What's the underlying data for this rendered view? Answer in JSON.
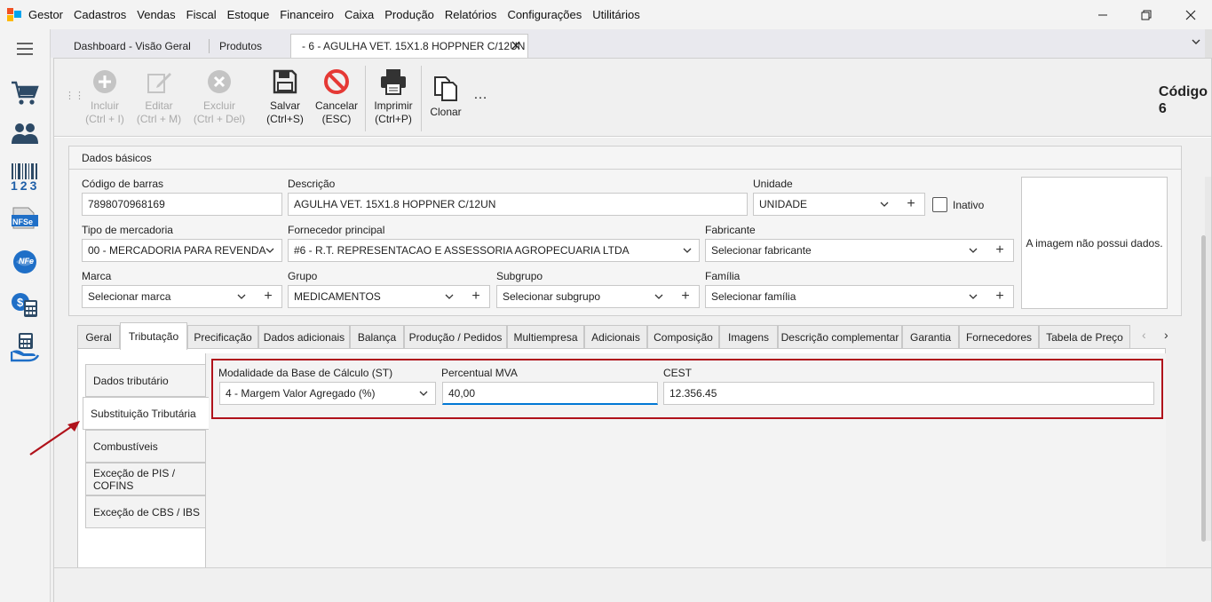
{
  "menu": {
    "items": [
      "Gestor",
      "Cadastros",
      "Vendas",
      "Fiscal",
      "Estoque",
      "Financeiro",
      "Caixa",
      "Produção",
      "Relatórios",
      "Configurações",
      "Utilitários"
    ]
  },
  "window": {
    "minimize": "—",
    "restore": "❐",
    "close": "✕"
  },
  "sidebar": {
    "icons": [
      "hamburger-menu-icon",
      "cart-icon",
      "users-icon",
      "barcode-123-icon",
      "nfse-icon",
      "nfe-icon",
      "calculator-icon",
      "cash-register-icon"
    ],
    "barcode_digits": "123",
    "nfse_text": "NFSe",
    "nfe_text": "NFe"
  },
  "doc_tabs": {
    "dashboard": "Dashboard - Visão Geral",
    "produtos": "Produtos",
    "produto_atual": "- 6 - AGULHA VET. 15X1.8 HOPPNER C/12UN",
    "close": "✕",
    "overflow": "⌄"
  },
  "toolbar": {
    "incluir": [
      "Incluir",
      "(Ctrl + I)"
    ],
    "editar": [
      "Editar",
      "(Ctrl + M)"
    ],
    "excluir": [
      "Excluir",
      "(Ctrl + Del)"
    ],
    "salvar": [
      "Salvar",
      "(Ctrl+S)"
    ],
    "cancelar": [
      "Cancelar",
      "(ESC)"
    ],
    "imprimir": [
      "Imprimir",
      "(Ctrl+P)"
    ],
    "clonar": "Clonar",
    "more": "…",
    "grip": "⋮⋮"
  },
  "codigo": {
    "label": "Código",
    "value": "6"
  },
  "dados_basicos": {
    "title": "Dados básicos",
    "codigo_barras": {
      "label": "Código de barras",
      "value": "7898070968169"
    },
    "descricao": {
      "label": "Descrição",
      "value": "AGULHA VET. 15X1.8 HOPPNER C/12UN"
    },
    "unidade": {
      "label": "Unidade",
      "value": "UNIDADE"
    },
    "inativo": {
      "label": "Inativo",
      "checked": false
    },
    "tipo_mercadoria": {
      "label": "Tipo de mercadoria",
      "value": "00 - MERCADORIA PARA REVENDA"
    },
    "fornecedor": {
      "label": "Fornecedor principal",
      "value": "#6 - R.T. REPRESENTACAO E ASSESSORIA AGROPECUARIA LTDA"
    },
    "fabricante": {
      "label": "Fabricante",
      "value": "Selecionar fabricante"
    },
    "marca": {
      "label": "Marca",
      "value": "Selecionar marca"
    },
    "grupo": {
      "label": "Grupo",
      "value": "MEDICAMENTOS"
    },
    "subgrupo": {
      "label": "Subgrupo",
      "value": "Selecionar subgrupo"
    },
    "familia": {
      "label": "Família",
      "value": "Selecionar família"
    },
    "imagem": "A imagem não possui dados.",
    "plus": "+"
  },
  "section_tabs": [
    "Geral",
    "Tributação",
    "Precificação",
    "Dados adicionais",
    "Balança",
    "Produção / Pedidos",
    "Multiempresa",
    "Adicionais",
    "Composição",
    "Imagens",
    "Descrição complementar",
    "Garantia",
    "Fornecedores",
    "Tabela de Preço"
  ],
  "section_active": "Tributação",
  "scroll_arrows": {
    "left": "‹",
    "right": "›"
  },
  "tributacao_tabs": [
    "Dados tributário",
    "Substituição Tributária",
    "Combustíveis",
    "Exceção de PIS / COFINS",
    "Exceção de CBS / IBS"
  ],
  "tributacao_active": "Substituição Tributária",
  "st": {
    "modalidade": {
      "label": "Modalidade da Base de Cálculo (ST)",
      "value": "4 - Margem Valor Agregado (%)"
    },
    "mva": {
      "label": "Percentual MVA",
      "value": "40,00"
    },
    "cest": {
      "label": "CEST",
      "value": "12.356.45"
    }
  },
  "colors": {
    "highlight": "#b0121b",
    "accent": "#0078d4"
  }
}
